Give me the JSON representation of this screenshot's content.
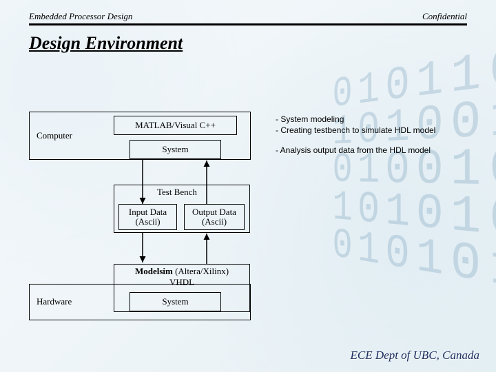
{
  "header": {
    "left": "Embedded Processor Design",
    "right": "Confidential"
  },
  "title": "Design Environment",
  "annotations": {
    "matlab_note_line1": "- System modeling",
    "matlab_note_line2": "- Creating testbench to simulate HDL model",
    "system_note": "- Analysis output data from the HDL model"
  },
  "blocks": {
    "computer_group_label": "Computer",
    "matlab": "MATLAB/Visual C++",
    "system_top": "System",
    "testbench_label": "Test Bench",
    "input_data_l1": "Input Data",
    "input_data_l2": "(Ascii)",
    "output_data_l1": "Output Data",
    "output_data_l2": "(Ascii)",
    "modelsim_l1": "Modelsim (Altera/Xilinx)",
    "modelsim_l2": "VHDL",
    "hardware_group_label": "Hardware",
    "system_bottom": "System"
  },
  "footer": "ECE Dept of UBC, Canada"
}
